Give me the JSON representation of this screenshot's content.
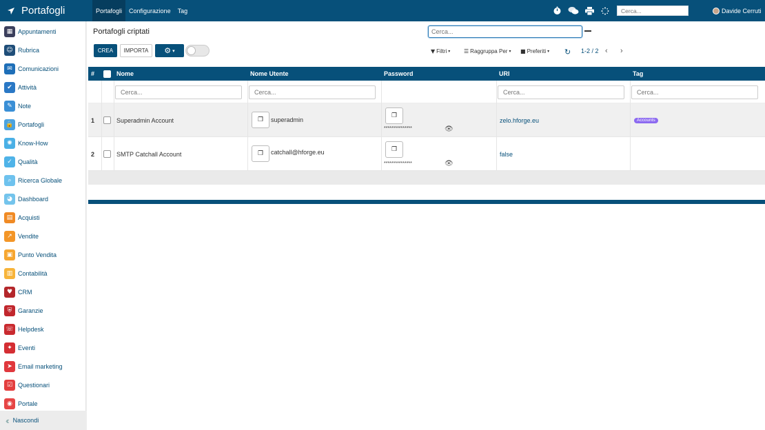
{
  "topbar": {
    "app_title": "Portafogli",
    "menu": [
      "Portafogli",
      "Configurazione",
      "Tag"
    ],
    "search_placeholder": "Cerca...",
    "user_name": "Davide Cerruti"
  },
  "sidebar": {
    "items": [
      {
        "label": "Appuntamenti",
        "color": "#3b3f5c",
        "icon": "calendar-icon"
      },
      {
        "label": "Rubrica",
        "color": "#1f4e79",
        "icon": "contacts-icon"
      },
      {
        "label": "Comunicazioni",
        "color": "#1e6fb8",
        "icon": "chat-icon"
      },
      {
        "label": "Attività",
        "color": "#2a78c5",
        "icon": "checkmark-icon"
      },
      {
        "label": "Note",
        "color": "#3a8fd6",
        "icon": "note-icon"
      },
      {
        "label": "Portafogli",
        "color": "#4aa3e0",
        "icon": "lock-icon"
      },
      {
        "label": "Know-How",
        "color": "#4ab0e6",
        "icon": "brain-icon"
      },
      {
        "label": "Qualità",
        "color": "#4fb3e8",
        "icon": "quality-icon"
      },
      {
        "label": "Ricerca Globale",
        "color": "#6ec2ee",
        "icon": "search-icon"
      },
      {
        "label": "Dashboard",
        "color": "#74c4ec",
        "icon": "dashboard-icon"
      },
      {
        "label": "Acquisti",
        "color": "#f08a24",
        "icon": "purchase-icon"
      },
      {
        "label": "Vendite",
        "color": "#f39628",
        "icon": "chart-icon"
      },
      {
        "label": "Punto Vendita",
        "color": "#f6a630",
        "icon": "pos-icon"
      },
      {
        "label": "Contabilità",
        "color": "#f7b43a",
        "icon": "accounting-icon"
      },
      {
        "label": "CRM",
        "color": "#b4272b",
        "icon": "crm-icon"
      },
      {
        "label": "Garanzie",
        "color": "#c1272d",
        "icon": "shield-icon"
      },
      {
        "label": "Helpdesk",
        "color": "#c92a2f",
        "icon": "headset-icon"
      },
      {
        "label": "Eventi",
        "color": "#d42e33",
        "icon": "ticket-icon"
      },
      {
        "label": "Email marketing",
        "color": "#e0383d",
        "icon": "paper-plane-icon"
      },
      {
        "label": "Questionari",
        "color": "#e33f3f",
        "icon": "survey-icon"
      },
      {
        "label": "Portale",
        "color": "#e64545",
        "icon": "globe-icon"
      }
    ],
    "hide_label": "Nascondi"
  },
  "main": {
    "title": "Portafogli criptati",
    "search_placeholder": "Cerca...",
    "buttons": {
      "create": "CREA",
      "import": "IMPORTA"
    },
    "filters": "Filtri",
    "group_by": "Raggruppa Per",
    "favorites": "Preferiti",
    "pager": "1-2 / 2",
    "columns": {
      "index": "#",
      "name": "Nome",
      "username": "Nome Utente",
      "password": "Password",
      "uri": "URI",
      "tag": "Tag"
    },
    "filter_placeholder": "Cerca...",
    "rows": [
      {
        "index": "1",
        "name": "Superadmin Account",
        "username": "superadmin",
        "password": "***************",
        "uri": "zelo.hforge.eu",
        "tag": "Accounts"
      },
      {
        "index": "2",
        "name": "SMTP Catchall Account",
        "username": "catchall@hforge.eu",
        "password": "***************",
        "uri": "false",
        "tag": ""
      }
    ]
  }
}
